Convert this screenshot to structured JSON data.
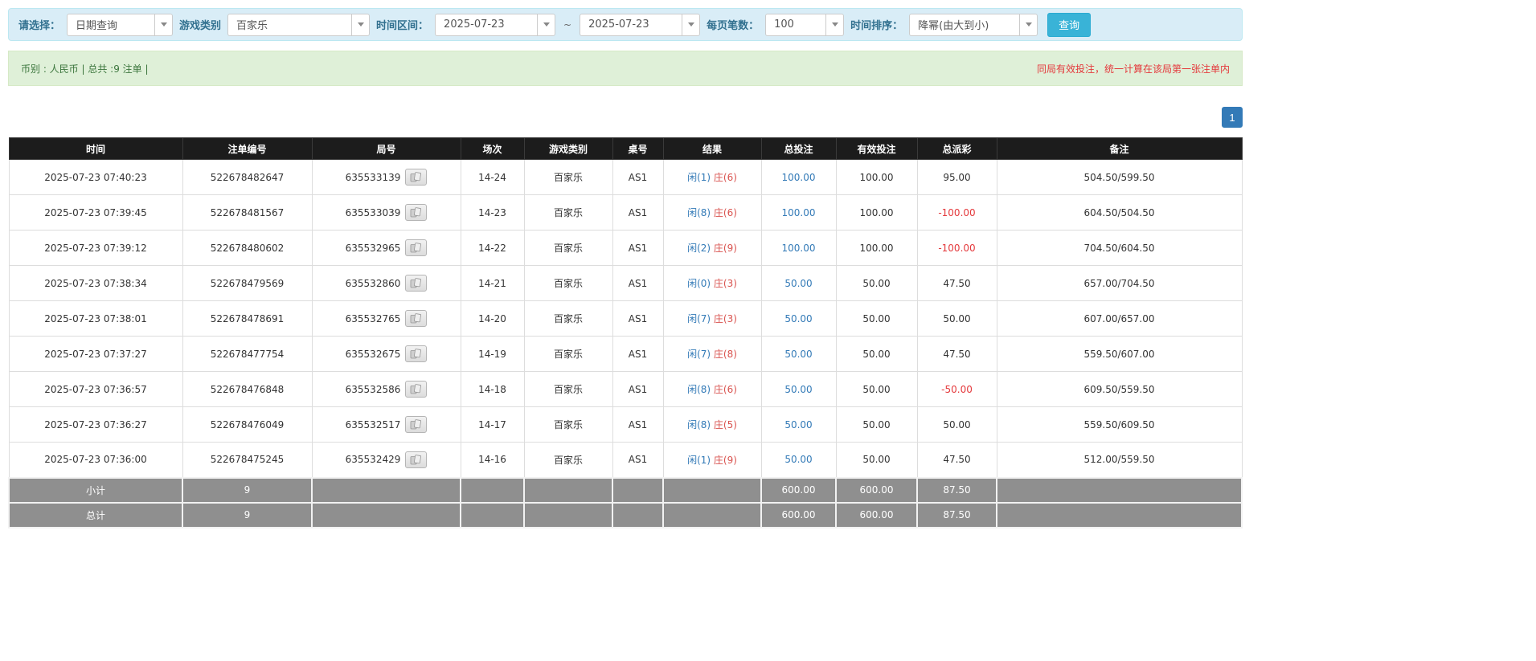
{
  "filters": {
    "select_label": "请选择：",
    "select_value": "日期查询",
    "game_type_label": "游戏类别",
    "game_type_value": "百家乐",
    "time_range_label": "时间区间：",
    "date_from": "2025-07-23",
    "tilde": "~",
    "date_to": "2025-07-23",
    "page_size_label": "每页笔数：",
    "page_size_value": "100",
    "sort_label": "时间排序：",
    "sort_value": "降幂(由大到小)",
    "search_button": "查询"
  },
  "info_bar": {
    "left": "币别 : 人民币 | 总共 :9 注单 |",
    "right": "同局有效投注，统一计算在该局第一张注单内"
  },
  "pagination": {
    "current": "1"
  },
  "table": {
    "headers": [
      "时间",
      "注单编号",
      "局号",
      "场次",
      "游戏类别",
      "桌号",
      "结果",
      "总投注",
      "有效投注",
      "总派彩",
      "备注"
    ],
    "rows": [
      {
        "time": "2025-07-23 07:40:23",
        "bet_id": "522678482647",
        "round_id": "635533139",
        "session": "14-24",
        "game": "百家乐",
        "table_no": "AS1",
        "result_player": "闲(1)",
        "result_banker": "庄(6)",
        "total_bet": "100.00",
        "valid_bet": "100.00",
        "payout": "95.00",
        "remark": "504.50/599.50"
      },
      {
        "time": "2025-07-23 07:39:45",
        "bet_id": "522678481567",
        "round_id": "635533039",
        "session": "14-23",
        "game": "百家乐",
        "table_no": "AS1",
        "result_player": "闲(8)",
        "result_banker": "庄(6)",
        "total_bet": "100.00",
        "valid_bet": "100.00",
        "payout": "-100.00",
        "remark": "604.50/504.50"
      },
      {
        "time": "2025-07-23 07:39:12",
        "bet_id": "522678480602",
        "round_id": "635532965",
        "session": "14-22",
        "game": "百家乐",
        "table_no": "AS1",
        "result_player": "闲(2)",
        "result_banker": "庄(9)",
        "total_bet": "100.00",
        "valid_bet": "100.00",
        "payout": "-100.00",
        "remark": "704.50/604.50"
      },
      {
        "time": "2025-07-23 07:38:34",
        "bet_id": "522678479569",
        "round_id": "635532860",
        "session": "14-21",
        "game": "百家乐",
        "table_no": "AS1",
        "result_player": "闲(0)",
        "result_banker": "庄(3)",
        "total_bet": "50.00",
        "valid_bet": "50.00",
        "payout": "47.50",
        "remark": "657.00/704.50"
      },
      {
        "time": "2025-07-23 07:38:01",
        "bet_id": "522678478691",
        "round_id": "635532765",
        "session": "14-20",
        "game": "百家乐",
        "table_no": "AS1",
        "result_player": "闲(7)",
        "result_banker": "庄(3)",
        "total_bet": "50.00",
        "valid_bet": "50.00",
        "payout": "50.00",
        "remark": "607.00/657.00"
      },
      {
        "time": "2025-07-23 07:37:27",
        "bet_id": "522678477754",
        "round_id": "635532675",
        "session": "14-19",
        "game": "百家乐",
        "table_no": "AS1",
        "result_player": "闲(7)",
        "result_banker": "庄(8)",
        "total_bet": "50.00",
        "valid_bet": "50.00",
        "payout": "47.50",
        "remark": "559.50/607.00"
      },
      {
        "time": "2025-07-23 07:36:57",
        "bet_id": "522678476848",
        "round_id": "635532586",
        "session": "14-18",
        "game": "百家乐",
        "table_no": "AS1",
        "result_player": "闲(8)",
        "result_banker": "庄(6)",
        "total_bet": "50.00",
        "valid_bet": "50.00",
        "payout": "-50.00",
        "remark": "609.50/559.50"
      },
      {
        "time": "2025-07-23 07:36:27",
        "bet_id": "522678476049",
        "round_id": "635532517",
        "session": "14-17",
        "game": "百家乐",
        "table_no": "AS1",
        "result_player": "闲(8)",
        "result_banker": "庄(5)",
        "total_bet": "50.00",
        "valid_bet": "50.00",
        "payout": "50.00",
        "remark": "559.50/609.50"
      },
      {
        "time": "2025-07-23 07:36:00",
        "bet_id": "522678475245",
        "round_id": "635532429",
        "session": "14-16",
        "game": "百家乐",
        "table_no": "AS1",
        "result_player": "闲(1)",
        "result_banker": "庄(9)",
        "total_bet": "50.00",
        "valid_bet": "50.00",
        "payout": "47.50",
        "remark": "512.00/559.50"
      }
    ],
    "subtotal": {
      "label": "小计",
      "count": "9",
      "total_bet": "600.00",
      "valid_bet": "600.00",
      "payout": "87.50"
    },
    "total": {
      "label": "总计",
      "count": "9",
      "total_bet": "600.00",
      "valid_bet": "600.00",
      "payout": "87.50"
    }
  },
  "colors": {
    "filter_bar_bg": "#d9edf7",
    "info_bar_bg": "#dff0d8",
    "label_blue": "#31708f",
    "link_blue": "#337ab7",
    "banker_red": "#d9534f",
    "negative_red": "#e4393c",
    "note_red": "#e4393c",
    "search_button_bg": "#39b3d7",
    "table_header_bg": "#1c1c1c",
    "footer_row_bg": "#8f8f8f",
    "pagination_active_bg": "#337ab7"
  }
}
